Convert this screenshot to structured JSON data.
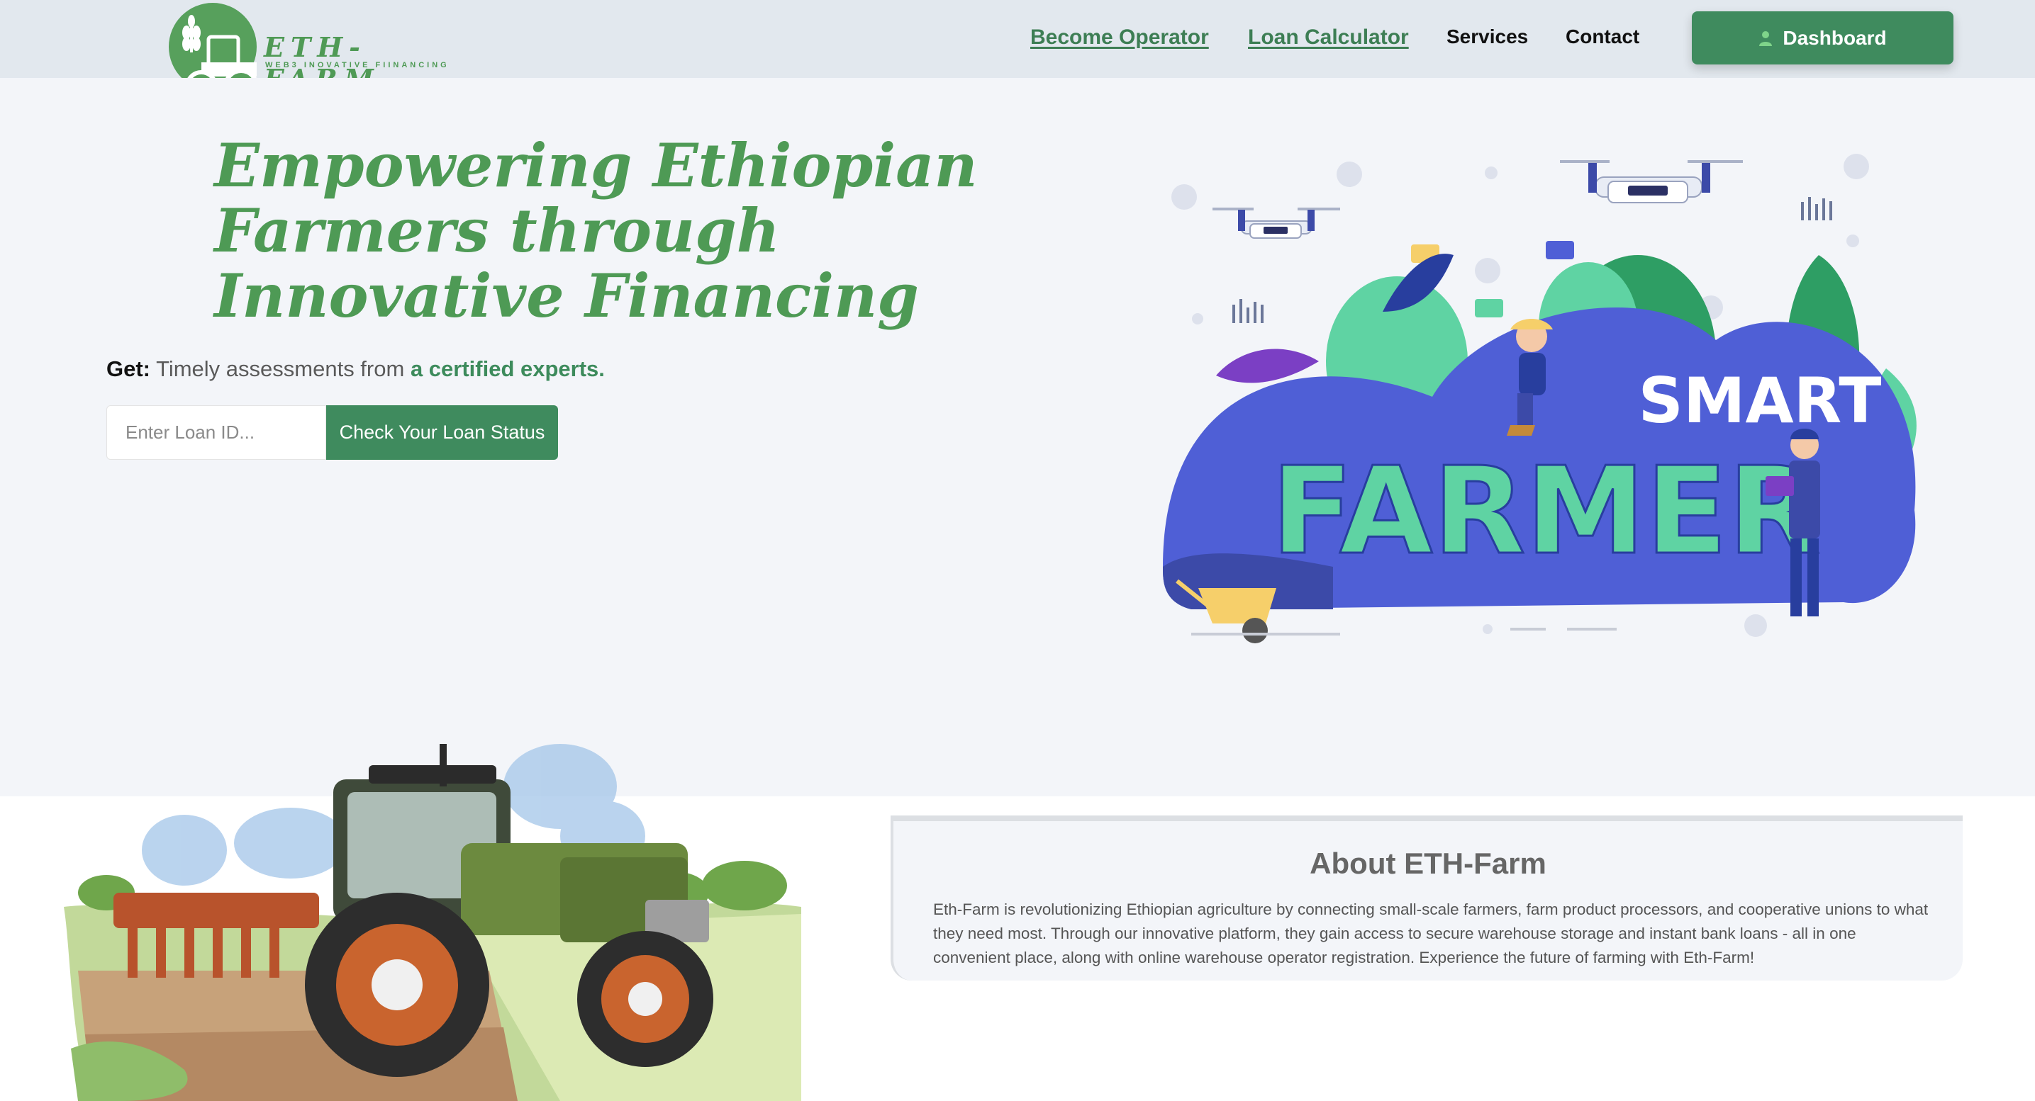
{
  "brand": {
    "title": "ETH-FARM",
    "tagline": "WEB3 INOVATIVE FIINANCING"
  },
  "nav": {
    "become_operator": "Become Operator",
    "loan_calculator": "Loan Calculator",
    "services": "Services",
    "contact": "Contact",
    "dashboard": "Dashboard"
  },
  "hero": {
    "headline": "Empowering Ethiopian Farmers through Innovative Financing",
    "get_label": "Get:",
    "get_text": "Timely assessments from",
    "get_highlight": "a certified experts.",
    "loan_placeholder": "Enter Loan ID...",
    "check_button": "Check Your Loan Status",
    "illustration_text_top": "SMART",
    "illustration_text_bottom": "FARMER"
  },
  "about": {
    "title": "About ETH-Farm",
    "body": "Eth-Farm is revolutionizing Ethiopian agriculture by connecting small-scale farmers, farm product processors, and cooperative unions to what they need most. Through our innovative platform, they gain access to secure warehouse storage and instant bank loans - all in one convenient place, along with online warehouse operator registration. Experience the future of farming with Eth-Farm!"
  },
  "colors": {
    "brand_green": "#4e9a55",
    "button_green": "#3f8b5e",
    "navbar_bg": "#e2e8ee",
    "hero_bg": "#f3f5f9",
    "illustration_blue": "#4f5fd6",
    "illustration_mint": "#5fd3a3"
  },
  "icons": [
    "tractor-logo-icon",
    "user-icon",
    "drone-icon",
    "tractor-illustration"
  ]
}
